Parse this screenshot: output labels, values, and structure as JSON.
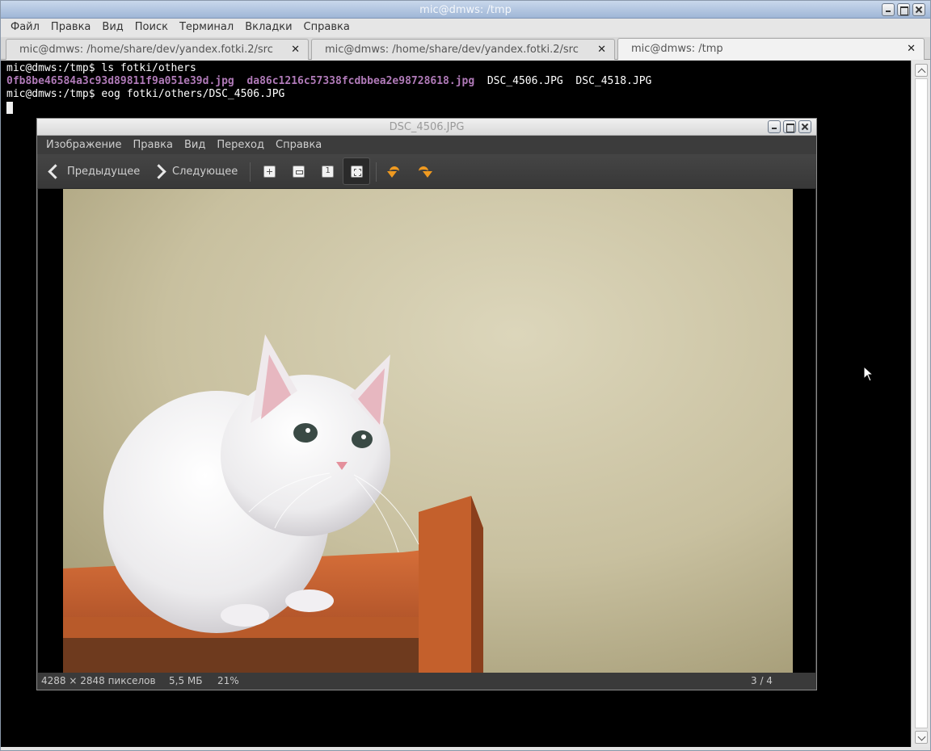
{
  "terminal_window": {
    "title": "mic@dmws: /tmp",
    "menu": [
      "Файл",
      "Правка",
      "Вид",
      "Поиск",
      "Терминал",
      "Вкладки",
      "Справка"
    ],
    "tabs": [
      {
        "label": "mic@dmws: /home/share/dev/yandex.fotki.2/src",
        "active": false
      },
      {
        "label": "mic@dmws: /home/share/dev/yandex.fotki.2/src",
        "active": false
      },
      {
        "label": "mic@dmws: /tmp",
        "active": true
      }
    ],
    "tab_close_glyph": "✕",
    "lines": {
      "line1": "mic@dmws:/tmp$ ls fotki/others",
      "files": {
        "f1": "0fb8be46584a3c93d89811f9a051e39d.jpg",
        "f2": "da86c1216c57338fcdbbea2e98728618.jpg",
        "f3": "DSC_4506.JPG",
        "f4": "DSC_4518.JPG"
      },
      "line3": "mic@dmws:/tmp$ eog fotki/others/DSC_4506.JPG"
    }
  },
  "eog_window": {
    "title": "DSC_4506.JPG",
    "menu": [
      "Изображение",
      "Правка",
      "Вид",
      "Переход",
      "Справка"
    ],
    "toolbar": {
      "prev_label": "Предыдущее",
      "next_label": "Следующее"
    },
    "status": {
      "dimensions": "4288 × 2848 пикселов",
      "size": "5,5 МБ",
      "zoom": "21%",
      "position": "3 / 4"
    }
  },
  "colors": {
    "terminal_bg": "#000000",
    "hash_file_color": "#b07ab8",
    "rotate_icon": "#f09a20"
  }
}
